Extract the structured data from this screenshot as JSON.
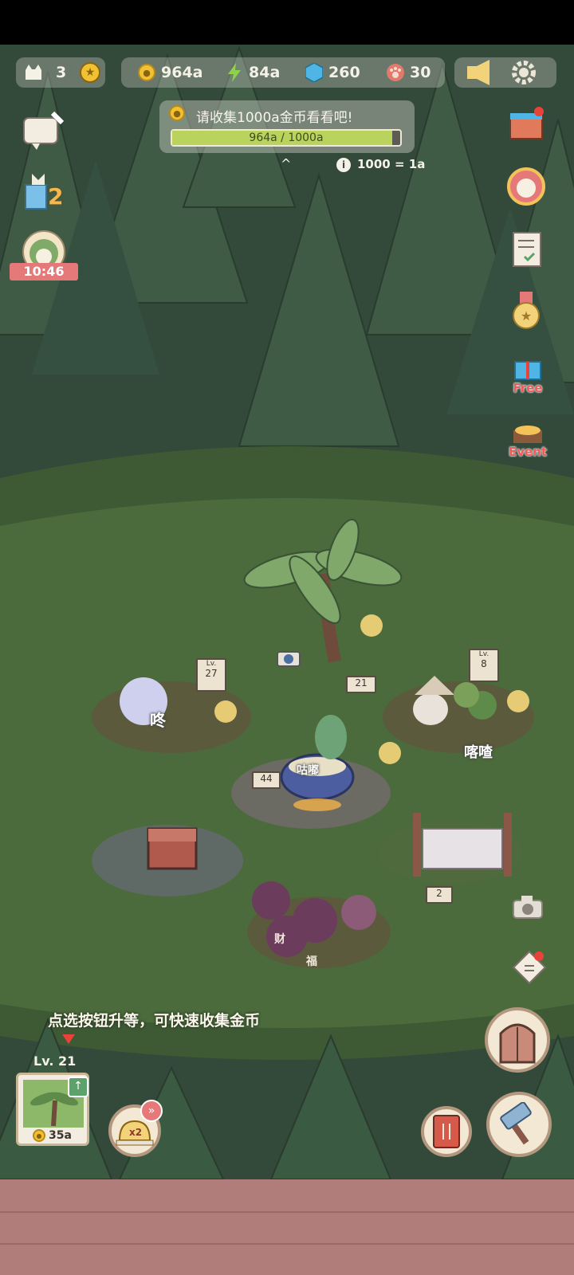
{
  "hud": {
    "cats": "3",
    "coins": "964a",
    "energy": "84a",
    "gems": "260",
    "paws": "30"
  },
  "quest": {
    "text": "请收集1000a金币看看吧!",
    "progress_label": "964a / 1000a",
    "progress_fraction": 0.964,
    "rate": "1000 = 1a"
  },
  "left_panel": {
    "badge_number": "2",
    "timer": "10:46"
  },
  "right_panel": {
    "free_label": "Free",
    "event_label": "Event"
  },
  "scene": {
    "sign_lv27": "27",
    "sign_lv8": "8",
    "sign_lv_prefix": "Lv.",
    "sign_21": "21",
    "sign_44": "44",
    "sign_2": "2",
    "bubble_dong": "咚",
    "bubble_gulu": "咕嘟",
    "bubble_kacha": "喀喳",
    "jar_cai": "财",
    "jar_fu": "福"
  },
  "hint": "点选按钮升等，可快速收集金币",
  "upgrade": {
    "level": "Lv. 21",
    "cost": "35a"
  },
  "speed": {
    "label": "x2"
  },
  "colors": {
    "forest_dark": "#2f4737",
    "grass": "#4a6a3a",
    "quest_fill": "#b9d35d",
    "ground": "#b17d7a"
  }
}
